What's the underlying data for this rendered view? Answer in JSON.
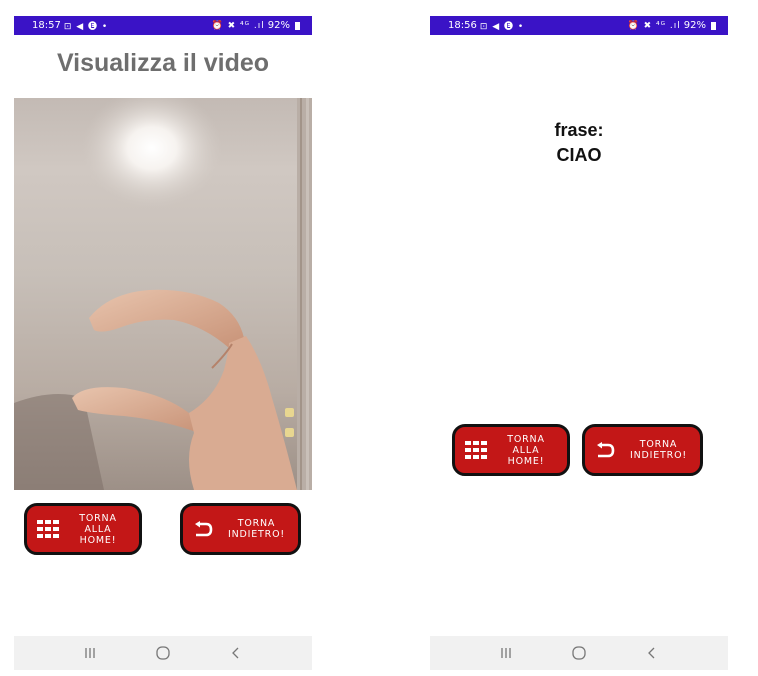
{
  "left_screen": {
    "status_bar": {
      "time": "18:57",
      "glyphs": "⊡ ◀ 🅔 •",
      "right_glyphs": "⏰ ✖ ⁴ᴳ .ıl",
      "battery": "92%"
    },
    "title": "Visualizza il video",
    "buttons": {
      "home_label": "TORNA\nALLA\nHOME!",
      "back_label": "TORNA\nINDIETRO!"
    }
  },
  "right_screen": {
    "status_bar": {
      "time": "18:56",
      "glyphs": "⊡ ◀ 🅔 •",
      "right_glyphs": "⏰ ✖ ⁴ᴳ .ıl",
      "battery": "92%"
    },
    "phrase_label": "frase:",
    "phrase_value": "CIAO",
    "buttons": {
      "home_label": "TORNA\nALLA\nHOME!",
      "back_label": "TORNA\nINDIETRO!"
    }
  },
  "colors": {
    "status_bar": "#3a13c6",
    "button_fill": "#c31717",
    "button_border": "#111111",
    "title_gray": "#6e6e6e",
    "nav_bar": "#f1f1f1"
  },
  "icons": {
    "home": "grid-icon",
    "back": "return-arrow-icon",
    "nav_recent": "recent-apps-icon",
    "nav_home": "home-circle-icon",
    "nav_back": "back-chevron-icon"
  }
}
